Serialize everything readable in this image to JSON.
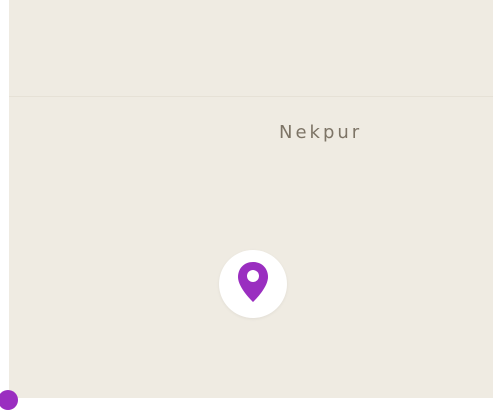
{
  "map": {
    "place_label": "Nekpur",
    "land_color": "#efebe2",
    "marker_color": "#9a2ec0",
    "marker_icon": "location-pin-icon"
  }
}
